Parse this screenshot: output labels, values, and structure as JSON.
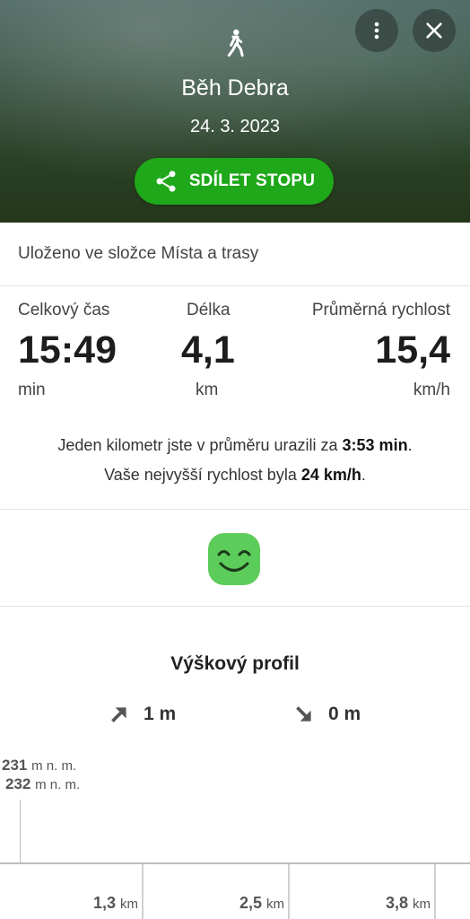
{
  "header": {
    "activity_icon": "walk-icon",
    "title": "Běh Debra",
    "date": "24. 3. 2023",
    "share_label": "SDÍLET STOPU",
    "share_icon": "share-icon",
    "menu_icon": "more-vert-icon",
    "close_icon": "close-icon",
    "accent_color": "#1fa81a"
  },
  "folder": {
    "text": "Uloženo ve složce Místa a trasy"
  },
  "stats": {
    "total_time": {
      "label": "Celkový čas",
      "value": "15:49",
      "unit": "min"
    },
    "length": {
      "label": "Délka",
      "value": "4,1",
      "unit": "km"
    },
    "avg_speed": {
      "label": "Průměrná rychlost",
      "value": "15,4",
      "unit": "km/h"
    }
  },
  "summary": {
    "line1_prefix": "Jeden kilometr jste v průměru urazili za ",
    "line1_value": "3:53 min",
    "line1_suffix": ".",
    "line2_prefix": "Vaše nejvyšší rychlost byla ",
    "line2_value": "24 km/h",
    "line2_suffix": "."
  },
  "rating": {
    "icon": "smiley-icon",
    "color": "#5ccc5a"
  },
  "elevation_profile": {
    "title": "Výškový profil",
    "ascent": "1 m",
    "descent": "0 m",
    "max_alt_value": "231",
    "min_alt_value": "232",
    "alt_unit": "m n. m.",
    "distance_ticks": [
      {
        "value": "1,3",
        "unit": "km"
      },
      {
        "value": "2,5",
        "unit": "km"
      },
      {
        "value": "3,8",
        "unit": "km"
      }
    ]
  }
}
